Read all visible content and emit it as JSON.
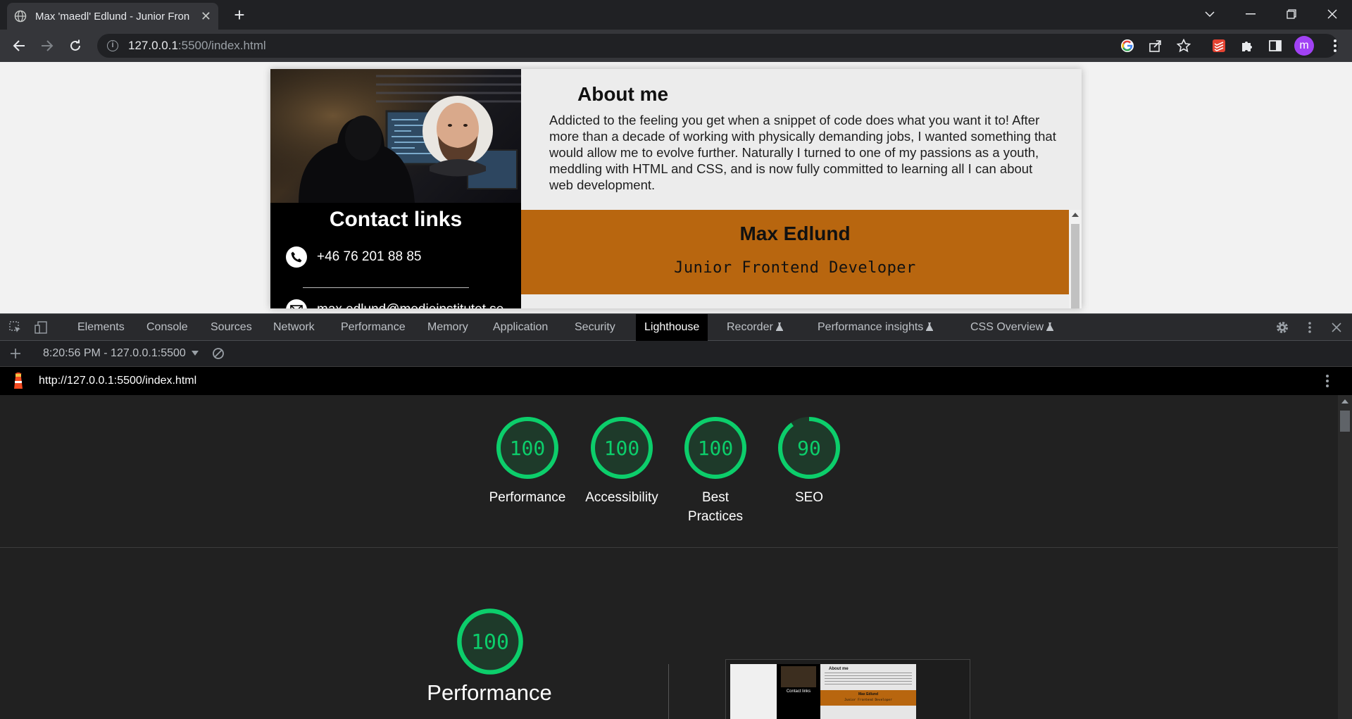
{
  "browser": {
    "tab_title": "Max 'maedl' Edlund - Junior Fron",
    "url_host": "127.0.0.1",
    "url_path": ":5500/index.html",
    "profile_initial": "m"
  },
  "page": {
    "contact": {
      "title": "Contact links",
      "phone": "+46 76 201 88 85",
      "email": "max.edlund@medieinstitutet.se"
    },
    "about": {
      "title": "About me",
      "text": "Addicted to the feeling you get when a snippet of code does what you want it to! After more than a decade of working with physically demanding jobs, I wanted something that would allow me to evolve further. Naturally I turned to one of my passions as a youth, meddling with HTML and CSS, and is now fully committed to learning all I can about web development."
    },
    "banner": {
      "name": "Max Edlund",
      "role": "Junior Frontend Developer"
    }
  },
  "devtools": {
    "tabs": [
      "Elements",
      "Console",
      "Sources",
      "Network",
      "Performance",
      "Memory",
      "Application",
      "Security",
      "Lighthouse",
      "Recorder",
      "Performance insights",
      "CSS Overview"
    ],
    "active_tab": "Lighthouse",
    "report_selector": "8:20:56 PM - 127.0.0.1:5500",
    "report_url": "http://127.0.0.1:5500/index.html"
  },
  "lighthouse": {
    "scores": [
      {
        "value": "100",
        "label": "Performance",
        "fraction": 1.0
      },
      {
        "value": "100",
        "label": "Accessibility",
        "fraction": 1.0
      },
      {
        "value": "100",
        "label": "Best Practices",
        "fraction": 1.0
      },
      {
        "value": "90",
        "label": "SEO",
        "fraction": 0.9
      }
    ],
    "detail": {
      "value": "100",
      "label": "Performance",
      "fraction": 1.0
    },
    "colors": {
      "pass": "#0cce6b",
      "gauge_bg": "#1e3a2a"
    }
  },
  "thumbnail": {
    "about": "About me",
    "contact": "Contact links",
    "name": "Max Edlund",
    "role": "Junior Frontend Developer"
  }
}
